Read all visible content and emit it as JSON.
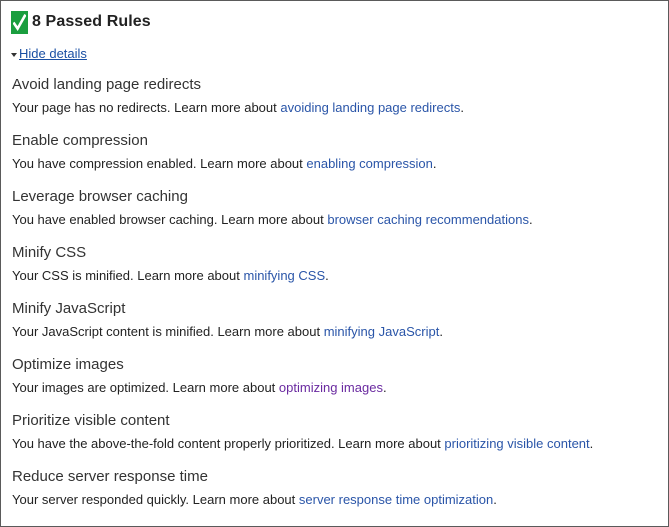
{
  "header": {
    "icon": "check-icon",
    "badge_color": "#1a9e3f",
    "title": "8 Passed Rules"
  },
  "toggle": {
    "icon": "caret-down-icon",
    "label": "Hide details"
  },
  "colors": {
    "link": "#2a55a8",
    "visited_link": "#6a2aa0"
  },
  "rules": [
    {
      "title": "Avoid landing page redirects",
      "desc": "Your page has no redirects. Learn more about ",
      "link": "avoiding landing page redirects",
      "end": "."
    },
    {
      "title": "Enable compression",
      "desc": "You have compression enabled. Learn more about ",
      "link": "enabling compression",
      "end": "."
    },
    {
      "title": "Leverage browser caching",
      "desc": "You have enabled browser caching. Learn more about ",
      "link": "browser caching recommendations",
      "end": "."
    },
    {
      "title": "Minify CSS",
      "desc": "Your CSS is minified. Learn more about ",
      "link": "minifying CSS",
      "end": "."
    },
    {
      "title": "Minify JavaScript",
      "desc": "Your JavaScript content is minified. Learn more about ",
      "link": "minifying JavaScript",
      "end": "."
    },
    {
      "title": "Optimize images",
      "desc": "Your images are optimized. Learn more about ",
      "link": "optimizing images",
      "end": "."
    },
    {
      "title": "Prioritize visible content",
      "desc": "You have the above-the-fold content properly prioritized. Learn more about ",
      "link": "prioritizing visible content",
      "end": "."
    },
    {
      "title": "Reduce server response time",
      "desc": "Your server responded quickly. Learn more about ",
      "link": "server response time optimization",
      "end": "."
    }
  ]
}
